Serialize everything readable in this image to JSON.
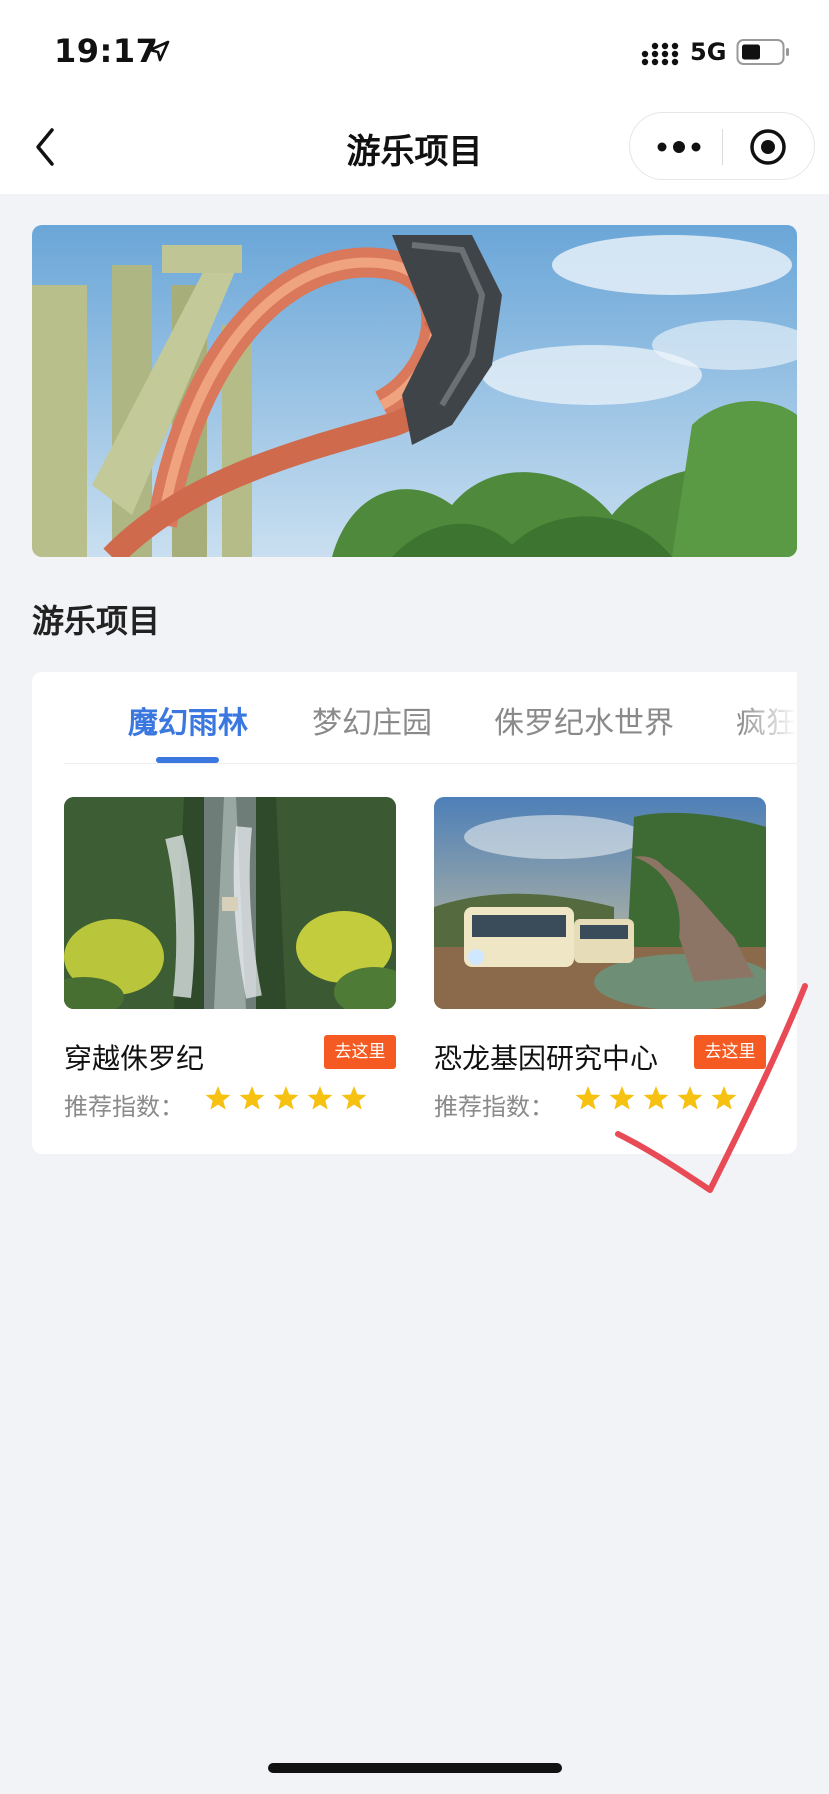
{
  "status": {
    "time": "19:17",
    "network": "5G"
  },
  "nav": {
    "title": "游乐项目"
  },
  "section": {
    "title": "游乐项目"
  },
  "tabs": [
    "魔幻雨林",
    "梦幻庄园",
    "侏罗纪水世界",
    "疯狂"
  ],
  "items": [
    {
      "name": "穿越侏罗纪",
      "go_label": "去这里",
      "rec_label": "推荐指数：",
      "rating": 5
    },
    {
      "name": "恐龙基因研究中心",
      "go_label": "去这里",
      "rec_label": "推荐指数：",
      "rating": 5
    }
  ],
  "colors": {
    "accent": "#3a78e0",
    "go_button": "#f45a22",
    "star": "#f6c111",
    "check": "#e84b55"
  }
}
